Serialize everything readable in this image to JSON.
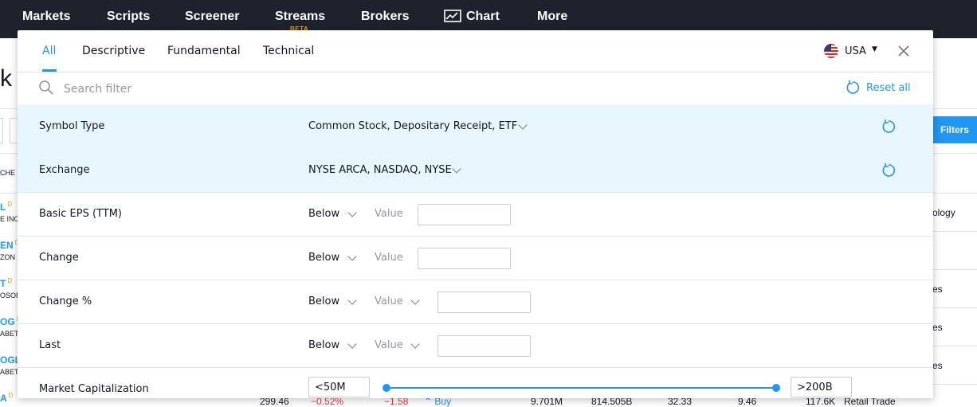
{
  "topnav": {
    "items": [
      "Markets",
      "Scripts",
      "Screener",
      "Streams",
      "Brokers",
      "Chart",
      "More"
    ],
    "beta_badge": "BETA"
  },
  "background": {
    "title_fragment": "k",
    "filters_button": "Filters",
    "column_fragment": "CHE",
    "rows": [
      {
        "symbol": "L",
        "badge": "D",
        "desc": "E INC",
        "right": "ology"
      },
      {
        "symbol": "EN",
        "badge": "D",
        "desc": "ZON C",
        "right": ""
      },
      {
        "symbol": "T",
        "badge": "D",
        "desc": "OSOF",
        "right": "es"
      },
      {
        "symbol": "OG",
        "badge": "D",
        "desc": "ABET",
        "right": "es"
      },
      {
        "symbol": "OGL",
        "badge": "D",
        "desc": "ABET",
        "right": "es"
      },
      {
        "symbol": "A",
        "badge": "D",
        "desc": "",
        "right": ""
      }
    ],
    "bottom_row": [
      "299.46",
      "−0.52%",
      "−1.58",
      "Buy",
      "9.701M",
      "814.505B",
      "32.33",
      "9.46",
      "117.6K",
      "Retail Trade"
    ]
  },
  "modal": {
    "tabs": [
      "All",
      "Descriptive",
      "Fundamental",
      "Technical"
    ],
    "active_tab": "All",
    "country": "USA",
    "search_placeholder": "Search filter",
    "reset_all": "Reset all",
    "filters": [
      {
        "label": "Symbol Type",
        "value": "Common Stock, Depositary Receipt, ETF",
        "active": true
      },
      {
        "label": "Exchange",
        "value": "NYSE ARCA, NASDAQ, NYSE",
        "active": true
      },
      {
        "label": "Basic EPS (TTM)",
        "operator": "Below",
        "value_placeholder": "Value"
      },
      {
        "label": "Change",
        "operator": "Below",
        "value_placeholder": "Value"
      },
      {
        "label": "Change %",
        "operator": "Below",
        "value_placeholder": "Value"
      },
      {
        "label": "Last",
        "operator": "Below",
        "value_placeholder": "Value"
      },
      {
        "label": "Market Capitalization",
        "min": "<50M",
        "max": ">200B",
        "range_fraction": [
          0,
          1
        ]
      }
    ]
  },
  "colors": {
    "accent": "#2196f3",
    "nav_bg": "#1e222d",
    "active_row": "#e8f6fd",
    "negative": "#f23645",
    "beta": "#ff9800"
  }
}
